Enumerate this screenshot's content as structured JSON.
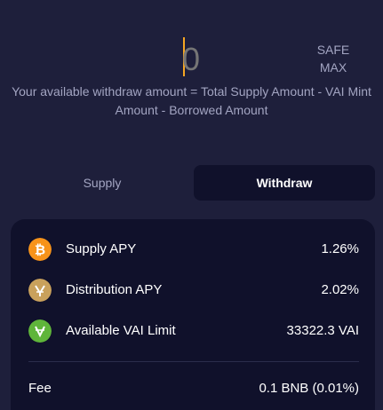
{
  "amount": {
    "value": "0",
    "safe_max_line1": "SAFE",
    "safe_max_line2": "MAX"
  },
  "hint": "Your available withdraw amount = Total Supply Amount - VAI Mint Amount - Borrowed Amount",
  "tabs": [
    {
      "label": "Supply",
      "active": false
    },
    {
      "label": "Withdraw",
      "active": true
    }
  ],
  "stats": {
    "supply_apy": {
      "label": "Supply APY",
      "value": "1.26%",
      "icon": "bitcoin-icon"
    },
    "distribution_apy": {
      "label": "Distribution APY",
      "value": "2.02%",
      "icon": "venus-token-icon"
    },
    "vai_limit": {
      "label": "Available VAI Limit",
      "value": "33322.3 VAI",
      "icon": "vai-token-icon"
    }
  },
  "fee": {
    "label": "Fee",
    "value": "0.1 BNB (0.01%)"
  },
  "colors": {
    "background": "#1e1f3b",
    "panel": "#10112b",
    "accent": "#f5a623",
    "muted_text": "#a3a5c2",
    "btc": "#f7931a",
    "xvs": "#c9a15c",
    "vai": "#5fb53a"
  }
}
